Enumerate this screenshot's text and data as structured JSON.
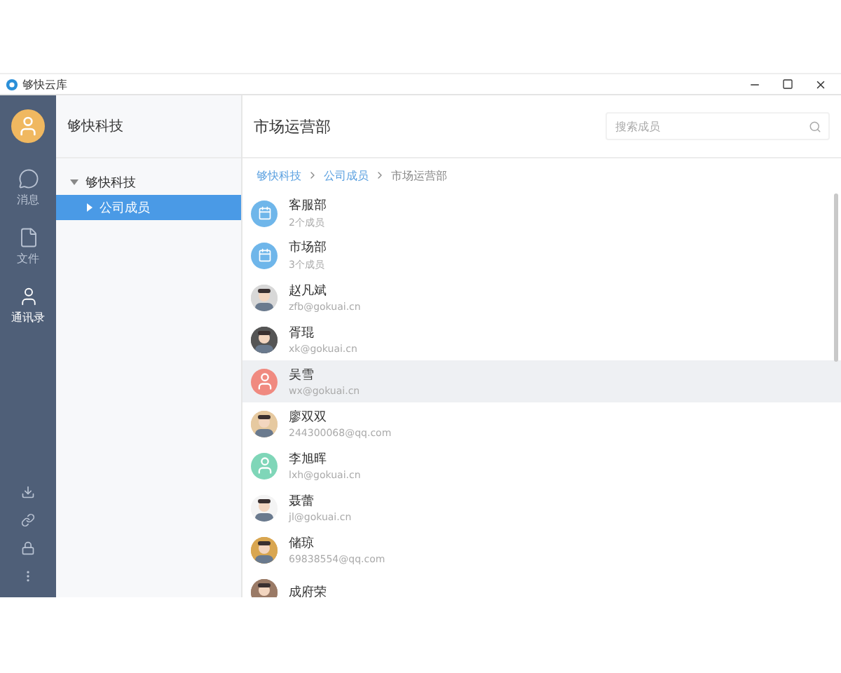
{
  "window": {
    "title": "够快云库"
  },
  "nav": [
    {
      "label": "消息",
      "selected": false
    },
    {
      "label": "文件",
      "selected": false
    },
    {
      "label": "通讯录",
      "selected": true
    }
  ],
  "tree": {
    "title": "够快科技",
    "items": [
      {
        "label": "够快科技",
        "expanded": true,
        "selected": false,
        "children": [
          {
            "label": "公司成员",
            "expanded": false,
            "selected": true
          }
        ]
      }
    ]
  },
  "main": {
    "title": "市场运营部",
    "search": {
      "placeholder": "搜索成员"
    },
    "breadcrumb": [
      "够快科技",
      "公司成员",
      "市场运营部"
    ],
    "rows": [
      {
        "kind": "group",
        "name": "客服部",
        "detail": "2个成员",
        "selected": false,
        "color": "#6fb6ea"
      },
      {
        "kind": "group",
        "name": "市场部",
        "detail": "3个成员",
        "selected": false,
        "color": "#6fb6ea"
      },
      {
        "name": "赵凡斌",
        "detail": "zfb@gokuai.cn",
        "selected": false,
        "color": "#d8d8d8"
      },
      {
        "name": "胥琨",
        "detail": "xk@gokuai.cn",
        "selected": false,
        "color": "#555555"
      },
      {
        "kind": "default",
        "name": "吴雪",
        "detail": "wx@gokuai.cn",
        "selected": true,
        "color": "#f08a80"
      },
      {
        "name": "廖双双",
        "detail": "244300068@qq.com",
        "selected": false,
        "color": "#e6c9a0"
      },
      {
        "kind": "default",
        "name": "李旭晖",
        "detail": "lxh@gokuai.cn",
        "selected": false,
        "color": "#7fd6b8"
      },
      {
        "name": "聂蕾",
        "detail": "jl@gokuai.cn",
        "selected": false,
        "color": "#f4f4f4"
      },
      {
        "name": "储琼",
        "detail": "69838554@qq.com",
        "selected": false,
        "color": "#d9a650"
      },
      {
        "name": "成府荣",
        "selected": false,
        "color": "#9a7a66"
      }
    ]
  }
}
